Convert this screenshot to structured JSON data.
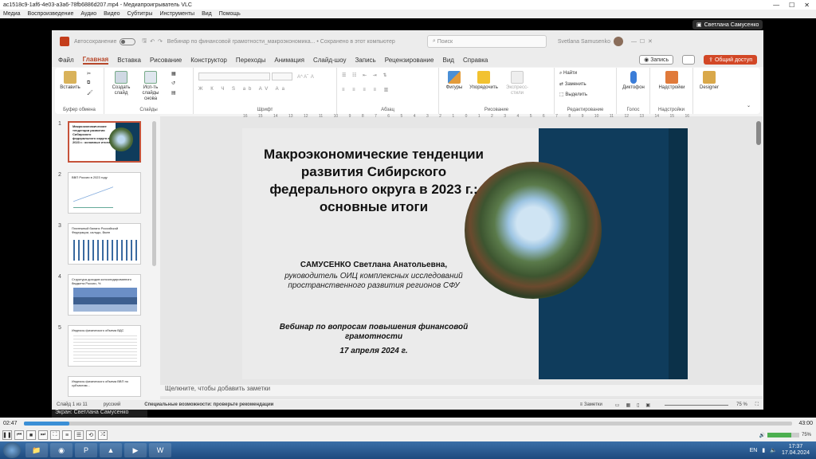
{
  "vlc": {
    "title": "ac1518c9-1af6-4e03-a3a6-78fb6886d207.mp4 - Медиапроигрыватель VLC",
    "menu": [
      "Медиа",
      "Воспроизведение",
      "Аудио",
      "Видео",
      "Субтитры",
      "Инструменты",
      "Вид",
      "Помощь"
    ],
    "time_elapsed": "02:47",
    "time_total": "43:00",
    "volume": "75%",
    "progress": 0.065
  },
  "ppt": {
    "autosave": "Автосохранение",
    "doc_title": "Вебинар по финансовой грамотности_макроэкономика... • Сохранено в этот компьютер",
    "search_placeholder": "Поиск",
    "user": "Svetlana Samusenko",
    "share_pill": "Светлана Самусенко",
    "tabs": [
      "Файл",
      "Главная",
      "Вставка",
      "Рисование",
      "Конструктор",
      "Переходы",
      "Анимация",
      "Слайд-шоу",
      "Запись",
      "Рецензирование",
      "Вид",
      "Справка"
    ],
    "record_btn": "Запись",
    "share_btn": "Общий доступ",
    "ribbon": {
      "paste": "Вставить",
      "clipboard": "Буфер обмена",
      "new_slide": "Создать слайд",
      "reuse": "Исп-ть слайды снова",
      "slides": "Слайды",
      "font_size": "",
      "font": "Шрифт",
      "paragraph": "Абзац",
      "shapes": "Фигуры",
      "arrange": "Упорядочить",
      "express": "Экспресс-стили",
      "drawing": "Рисование",
      "find": "Найти",
      "replace": "Заменить",
      "select": "Выделить",
      "editing": "Редактирование",
      "dictate": "Диктофон",
      "voice": "Голос",
      "addins": "Надстройки",
      "addins_group": "Надстройки",
      "designer": "Designer"
    },
    "thumbs": [
      {
        "num": "1",
        "text": "Макроэкономические тенденции развития Сибирского федерального округа в 2023 г.: основные итоги"
      },
      {
        "num": "2",
        "text": "ВВП России в 2023 году"
      },
      {
        "num": "3",
        "text": "Платежный баланс Российской Федерации, сальдо, $млн"
      },
      {
        "num": "4",
        "text": "Структура доходов консолидированного бюджета России, %"
      },
      {
        "num": "5",
        "text": "Индексы физического объема ВДС"
      },
      {
        "num": "",
        "text": "Индексы физического объема ВВП по субъектам..."
      }
    ],
    "notes": "Щелкните, чтобы добавить заметки",
    "status_slide": "Слайд 1 из 11",
    "status_lang": "русский",
    "status_access": "Специальные возможности: проверьте рекомендации",
    "status_notes": "Заметки",
    "zoom": "75 %"
  },
  "slide": {
    "title": "Макроэкономические тенденции развития Сибирского федерального округа в 2023 г.: основные итоги",
    "author": "САМУСЕНКО Светлана Анатольевна,",
    "role": "руководитель ОИЦ комплексных исследований пространственного развития регионов СФУ",
    "webinar": "Вебинар по вопросам повышения финансовой грамотности",
    "date": "17 апреля 2024 г."
  },
  "screen_label": "Экран: Светлана Самусенко",
  "taskbar": {
    "lang": "EN",
    "time": "17:37",
    "date": "17.04.2024"
  }
}
